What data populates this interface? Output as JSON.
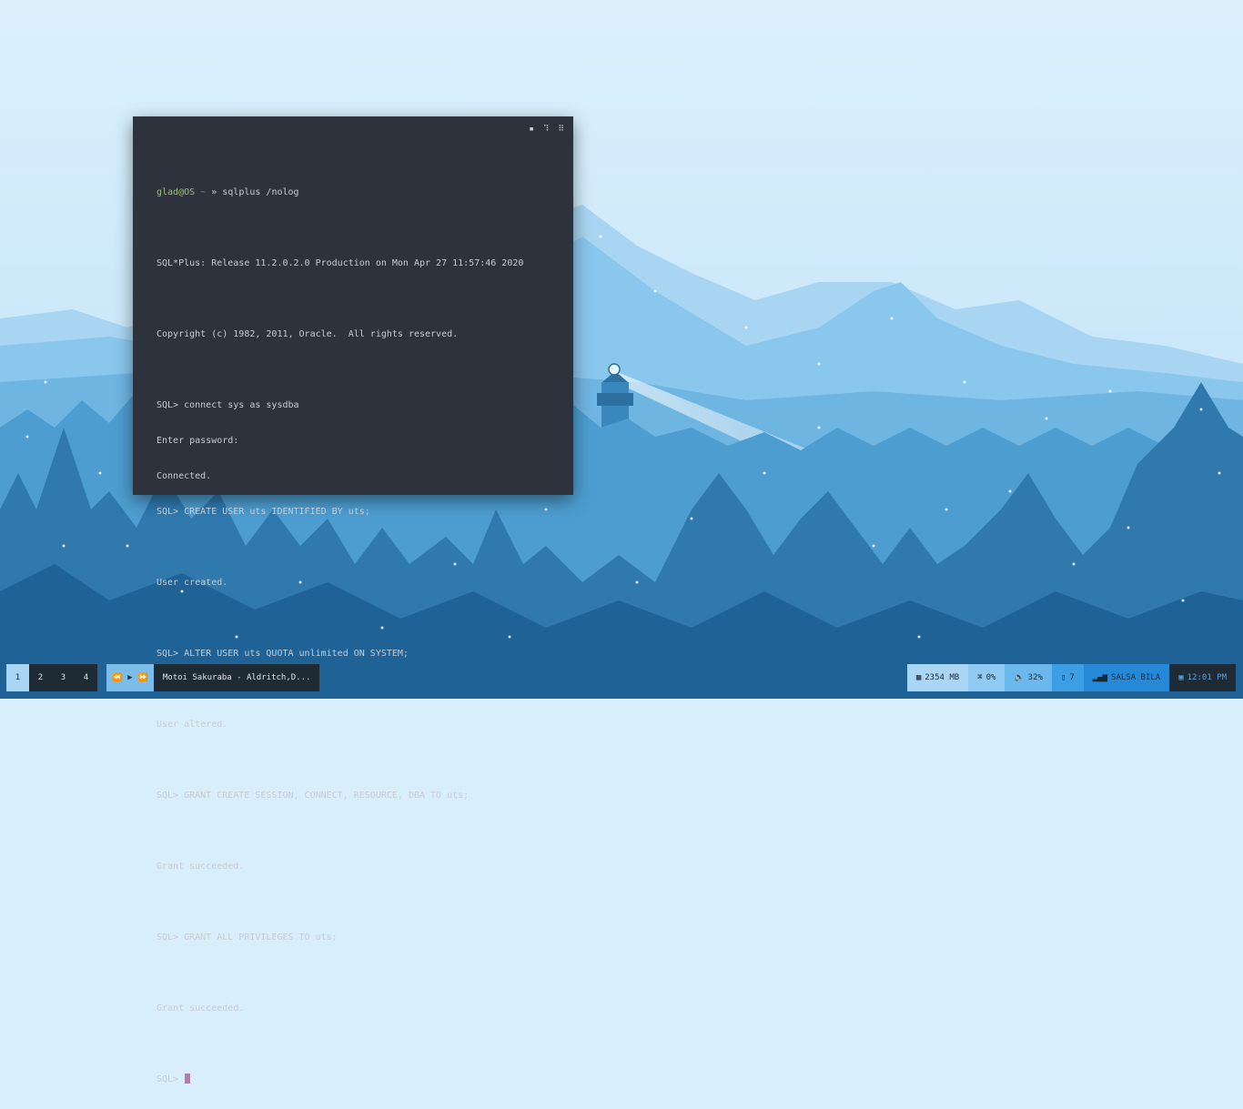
{
  "terminal": {
    "controls": {
      "minimize": "▪",
      "maximize": "⠹",
      "close": "⠿"
    },
    "lines": [
      {
        "prompt_user": "glad@OS",
        "prompt_tilde": " ~ ",
        "prompt_arrow": "» ",
        "text": "sqlplus /nolog"
      },
      {
        "text": ""
      },
      {
        "text": "SQL*Plus: Release 11.2.0.2.0 Production on Mon Apr 27 11:57:46 2020"
      },
      {
        "text": ""
      },
      {
        "text": "Copyright (c) 1982, 2011, Oracle.  All rights reserved."
      },
      {
        "text": ""
      },
      {
        "text": "SQL> connect sys as sysdba"
      },
      {
        "text": "Enter password:"
      },
      {
        "text": "Connected."
      },
      {
        "text": "SQL> CREATE USER uts IDENTIFIED BY uts;"
      },
      {
        "text": ""
      },
      {
        "text": "User created."
      },
      {
        "text": ""
      },
      {
        "text": "SQL> ALTER USER uts QUOTA unlimited ON SYSTEM;"
      },
      {
        "text": ""
      },
      {
        "text": "User altered."
      },
      {
        "text": ""
      },
      {
        "text": "SQL> GRANT CREATE SESSION, CONNECT, RESOURCE, DBA TO uts;"
      },
      {
        "text": ""
      },
      {
        "text": "Grant succeeded."
      },
      {
        "text": ""
      },
      {
        "text": "SQL> GRANT ALL PRIVILEGES TO uts;"
      },
      {
        "text": ""
      },
      {
        "text": "Grant succeeded."
      },
      {
        "text": ""
      },
      {
        "text": "SQL> "
      }
    ]
  },
  "taskbar": {
    "workspaces": [
      "1",
      "2",
      "3",
      "4"
    ],
    "active_workspace": "1",
    "media": {
      "prev": "⏪",
      "play": "▶",
      "next": "⏩"
    },
    "now_playing": "Motoi Sakuraba - Aldritch,D...",
    "memory": {
      "icon": "memory-icon",
      "glyph": "▦",
      "value": "2354 MB"
    },
    "cpu": {
      "icon": "cpu-icon",
      "glyph": "⌘",
      "value": "0%"
    },
    "volume": {
      "icon": "volume-icon",
      "glyph": "🔈",
      "value": "32%"
    },
    "updates": {
      "icon": "package-icon",
      "glyph": "▯",
      "value": "7"
    },
    "network": {
      "icon": "signal-icon",
      "glyph": "▂▄▆",
      "value": "SALSA BILA"
    },
    "clock": {
      "icon": "calendar-icon",
      "glyph": "▣",
      "value": "12:01 PM"
    }
  },
  "colors": {
    "terminal_bg": "#2e323c",
    "terminal_fg": "#c7ccd4",
    "prompt_user": "#98c379",
    "cursor": "#b07fb0",
    "bar_dark": "#1e2a34",
    "bar_accent": "#2589d8"
  }
}
